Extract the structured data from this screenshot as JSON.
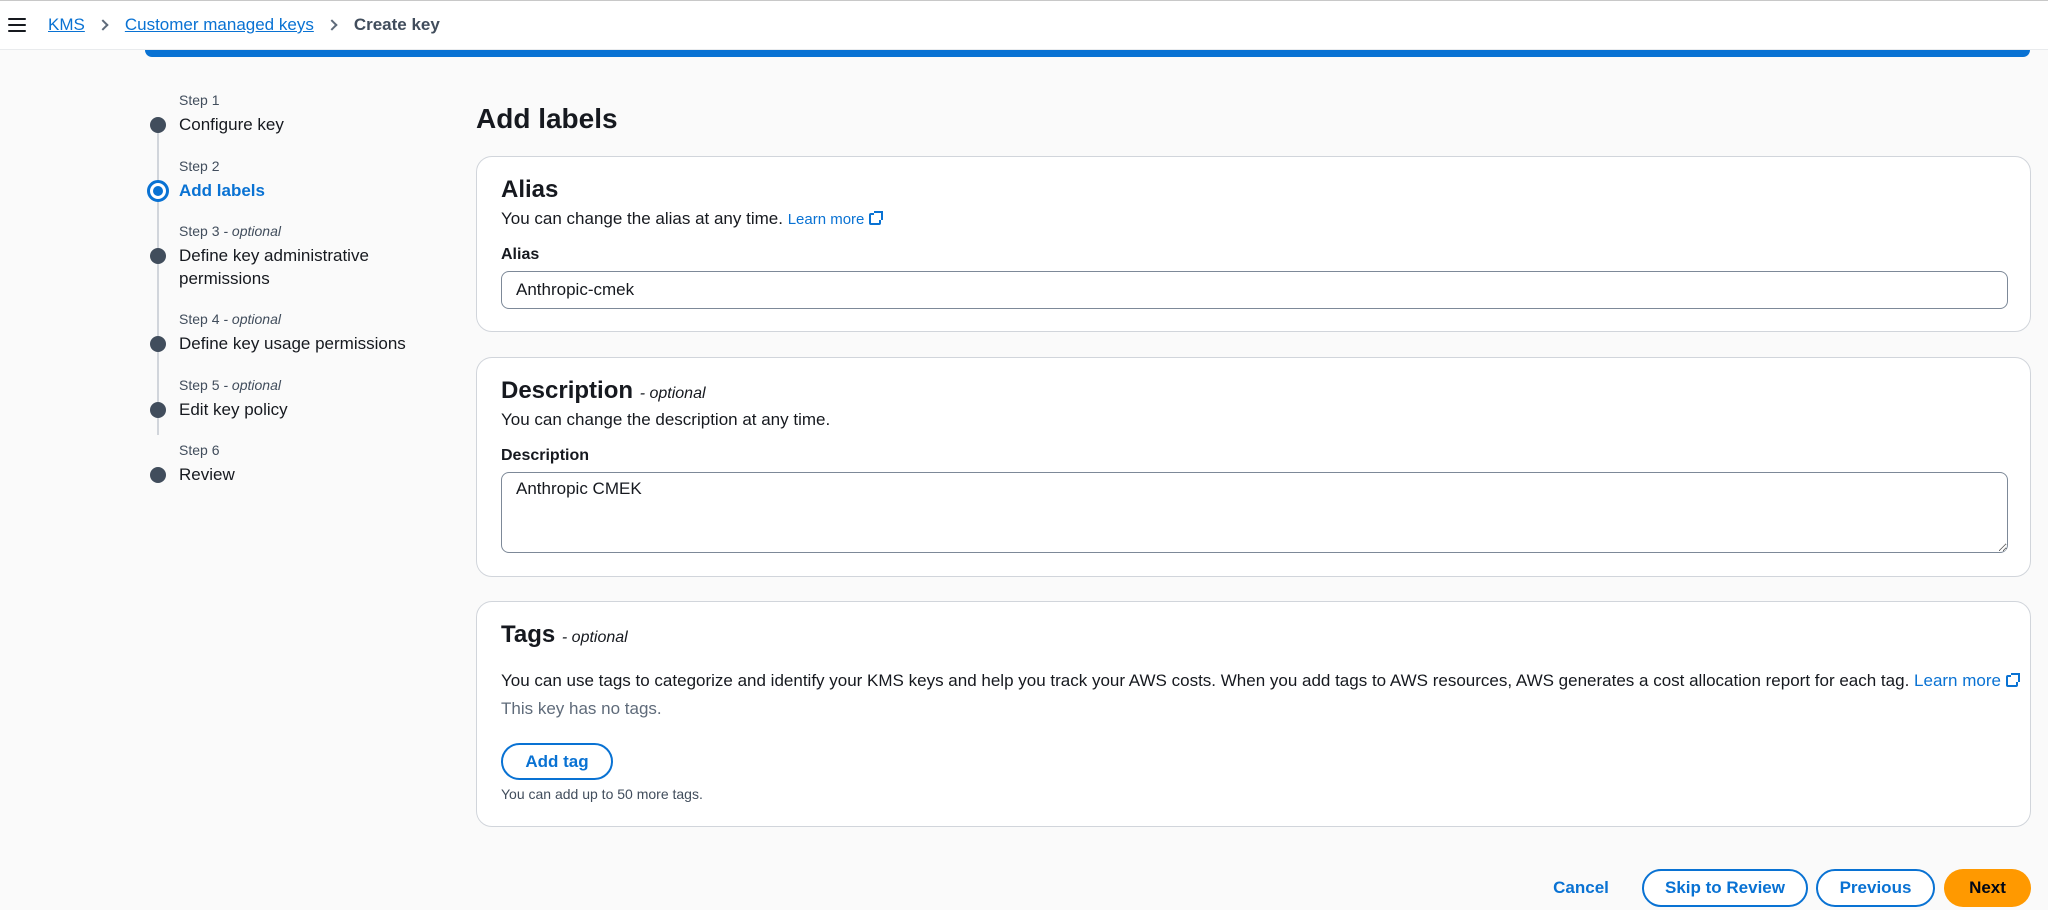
{
  "breadcrumb": {
    "items": [
      "KMS",
      "Customer managed keys"
    ],
    "current": "Create key"
  },
  "steps": [
    {
      "num": "Step 1",
      "optional": "",
      "title": "Configure key",
      "state": "done"
    },
    {
      "num": "Step 2",
      "optional": "",
      "title": "Add labels",
      "state": "active"
    },
    {
      "num": "Step 3",
      "optional": " - optional",
      "title": "Define key administrative permissions",
      "state": "pending"
    },
    {
      "num": "Step 4",
      "optional": " - optional",
      "title": "Define key usage permissions",
      "state": "pending"
    },
    {
      "num": "Step 5",
      "optional": " - optional",
      "title": "Edit key policy",
      "state": "pending"
    },
    {
      "num": "Step 6",
      "optional": "",
      "title": "Review",
      "state": "pending"
    }
  ],
  "page_title": "Add labels",
  "alias": {
    "heading": "Alias",
    "description": "You can change the alias at any time.",
    "learn_more": "Learn more",
    "field_label": "Alias",
    "value": "Anthropic-cmek"
  },
  "description": {
    "heading": "Description",
    "optional": "- optional",
    "description": "You can change the description at any time.",
    "field_label": "Description",
    "value": "Anthropic CMEK"
  },
  "tags": {
    "heading": "Tags",
    "optional": "- optional",
    "description": "You can use tags to categorize and identify your KMS keys and help you track your AWS costs. When you add tags to AWS resources, AWS generates a cost allocation report for each tag.",
    "learn_more": "Learn more",
    "empty_text": "This key has no tags.",
    "add_button": "Add tag",
    "limit_text": "You can add up to 50 more tags."
  },
  "footer": {
    "cancel": "Cancel",
    "skip": "Skip to Review",
    "previous": "Previous",
    "next": "Next"
  },
  "colors": {
    "accent": "#0972d3",
    "primary_button": "#ff9900"
  }
}
